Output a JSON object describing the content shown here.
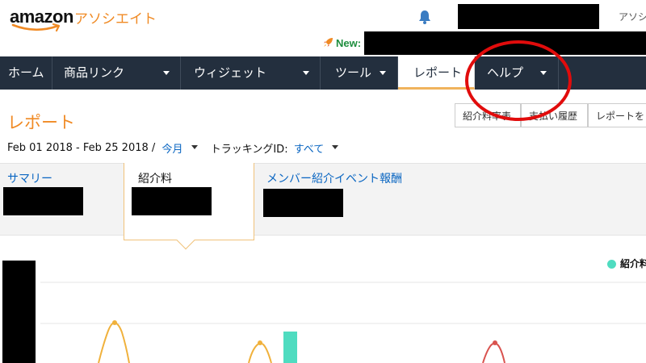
{
  "header": {
    "logo_wordmark": "amazon",
    "logo_program": "アソシエイト",
    "right_text": "アソシ",
    "new_label": "New:",
    "icons": [
      "bell-icon",
      "rocket-icon"
    ]
  },
  "nav": {
    "items": [
      {
        "label": "ホーム",
        "dropdown": false,
        "active": false
      },
      {
        "label": "商品リンク",
        "dropdown": true,
        "active": false
      },
      {
        "label": "ウィジェット",
        "dropdown": true,
        "active": false
      },
      {
        "label": "ツール",
        "dropdown": true,
        "active": false
      },
      {
        "label": "レポート",
        "dropdown": false,
        "active": true
      },
      {
        "label": "ヘルプ",
        "dropdown": true,
        "active": false
      }
    ]
  },
  "page": {
    "title": "レポート",
    "buttons": [
      "紹介料率表",
      "支払い履歴",
      "レポートを"
    ],
    "date_range": "Feb 01 2018 - Feb 25 2018 /",
    "period_link": "今月",
    "tracking_label": "トラッキングID:",
    "tracking_value": "すべて"
  },
  "summary": {
    "tabs": [
      {
        "label": "サマリー",
        "selected": false
      },
      {
        "label": "紹介料",
        "selected": true
      },
      {
        "label": "メンバー紹介イベント報酬",
        "selected": false
      }
    ]
  },
  "chart": {
    "legend": "紹介料"
  },
  "colors": {
    "accent_orange": "#f08a24",
    "nav_bg": "#232f3e",
    "link_blue": "#0a66c2",
    "legend_teal": "#4fdcc0",
    "annotation_red": "#e10c0c"
  }
}
